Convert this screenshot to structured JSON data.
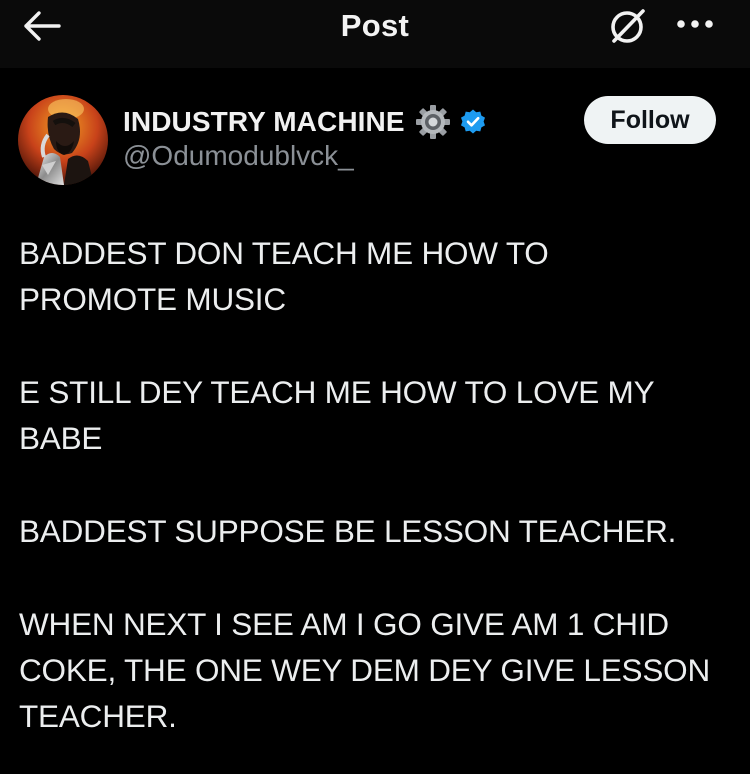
{
  "topbar": {
    "title": "Post",
    "back_icon": "arrow-left-icon",
    "grok_icon": "grok-icon",
    "more_icon": "more-horizontal-icon"
  },
  "author": {
    "display_name": "INDUSTRY MACHINE",
    "handle": "@Odumodublvck_",
    "badges": [
      "gear-icon",
      "verified-badge-icon"
    ],
    "follow_label": "Follow"
  },
  "post": {
    "paragraphs": [
      "BADDEST DON TEACH ME HOW TO\nPROMOTE MUSIC",
      "E STILL DEY TEACH ME HOW TO LOVE MY\nBABE",
      "BADDEST SUPPOSE BE LESSON TEACHER.",
      "WHEN NEXT I SEE AM I GO GIVE AM 1 CHID\nCOKE, THE ONE WEY DEM DEY GIVE LESSON\nTEACHER."
    ]
  },
  "colors": {
    "background": "#000000",
    "topbar": "#0a0a0a",
    "text": "#e7e9ea",
    "muted": "#8b9096",
    "verified": "#1d9bf0",
    "follow_bg": "#eff3f4"
  }
}
